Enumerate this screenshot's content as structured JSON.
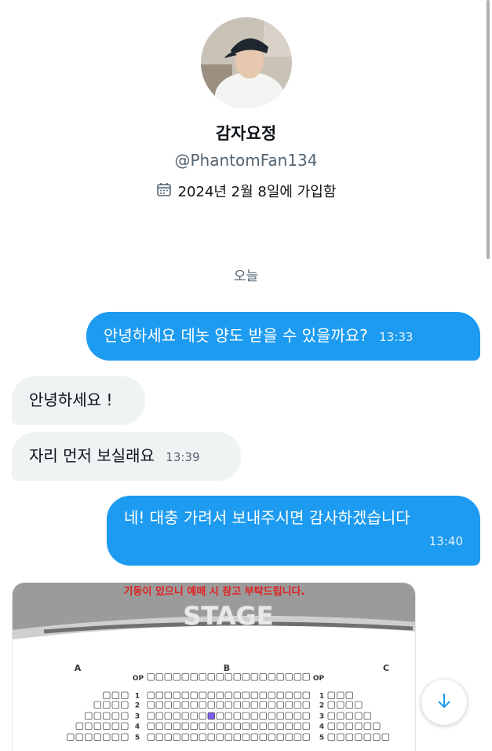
{
  "profile": {
    "display_name": "감자요정",
    "handle": "@PhantomFan134",
    "joined": "2024년 2월 8일에 가입함"
  },
  "day_separator": "오늘",
  "messages": [
    {
      "direction": "sent",
      "text": "안녕하세요 데놋 양도 받을 수 있을까요?",
      "time": "13:33"
    },
    {
      "direction": "received",
      "text": "안녕하세요 !",
      "time": ""
    },
    {
      "direction": "received",
      "text": "자리 먼저 보실래요",
      "time": "13:39"
    },
    {
      "direction": "sent",
      "text": "네! 대충 가려서 보내주시면 감사하겠습니다",
      "time": "13:40"
    }
  ],
  "seat_image": {
    "notice": "기둥이 있으니 예매 시 참고 부탁드립니다.",
    "stage_label": "STAGE",
    "sections": [
      "A",
      "B",
      "C"
    ],
    "op_label": "OP",
    "row_numbers": [
      "1",
      "2",
      "3",
      "4",
      "5"
    ]
  },
  "colors": {
    "sent_bubble": "#1d9bf0",
    "received_bubble": "#eff3f4",
    "selected_seat": "#7b5cf0",
    "notice_red": "#e02020"
  },
  "icons": {
    "calendar": "calendar-icon",
    "scroll_down": "arrow-down-icon"
  }
}
